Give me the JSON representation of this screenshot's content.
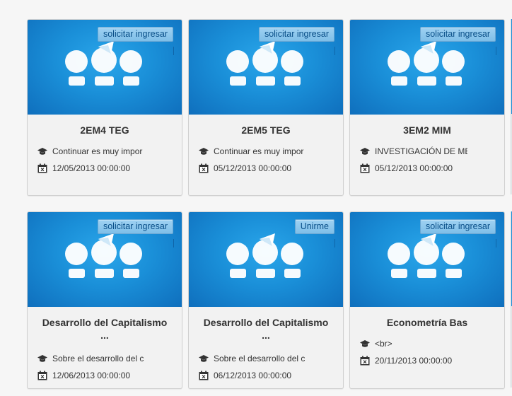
{
  "cards": [
    {
      "badge": "solicitar ingresar",
      "title": "2EM4 TEG",
      "title2": "",
      "desc": "Continuar es muy impor",
      "date": "12/05/2013 00:00:00"
    },
    {
      "badge": "solicitar ingresar",
      "title": "2EM5 TEG",
      "title2": "",
      "desc": "Continuar es muy impor",
      "date": "05/12/2013 00:00:00"
    },
    {
      "badge": "solicitar ingresar",
      "title": "3EM2 MIM",
      "title2": "",
      "desc": "INVESTIGACIÓN DE ME",
      "date": "05/12/2013 00:00:00"
    },
    {
      "badge": "solicitar ingresar",
      "title": "Desarrollo del Capitalismo",
      "title2": "...",
      "desc": "Sobre el desarrollo del c",
      "date": "12/06/2013 00:00:00"
    },
    {
      "badge": "Unirme",
      "title": "Desarrollo del Capitalismo",
      "title2": "...",
      "desc": "Sobre el desarrollo del c",
      "date": "06/12/2013 00:00:00"
    },
    {
      "badge": "solicitar ingresar",
      "title": "Econometría Bas",
      "title2": "",
      "desc": "<br>",
      "date": "20/11/2013 00:00:00"
    }
  ],
  "icons": {
    "desc": "graduation-cap-icon",
    "date": "calendar-icon",
    "banner": "group-people-icon"
  },
  "colors": {
    "banner": "#1a8fd8",
    "badge_bg": "#8cc8ee",
    "badge_text": "#0a4f88"
  }
}
